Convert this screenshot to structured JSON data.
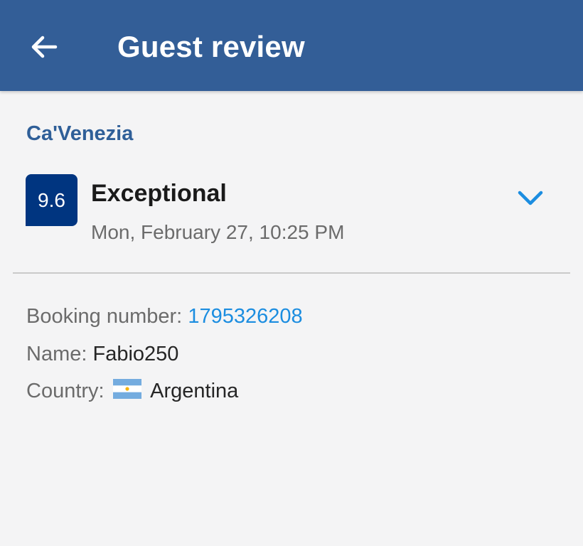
{
  "header": {
    "title": "Guest review",
    "back_icon": "arrow-left-icon"
  },
  "property": {
    "name": "Ca'Venezia"
  },
  "review": {
    "score": "9.6",
    "rating_label": "Exceptional",
    "date": "Mon, February 27, 10:25 PM",
    "expand_icon": "chevron-down-icon"
  },
  "details": {
    "booking_label": "Booking number:",
    "booking_number": "1795326208",
    "name_label": "Name:",
    "name_value": "Fabio250",
    "country_label": "Country:",
    "country_value": "Argentina",
    "country_flag_icon": "argentina-flag-icon"
  },
  "colors": {
    "app_bar": "#335e97",
    "score_badge": "#003580",
    "accent_link": "#1b8de0",
    "hotel_name": "#2f5f98"
  }
}
